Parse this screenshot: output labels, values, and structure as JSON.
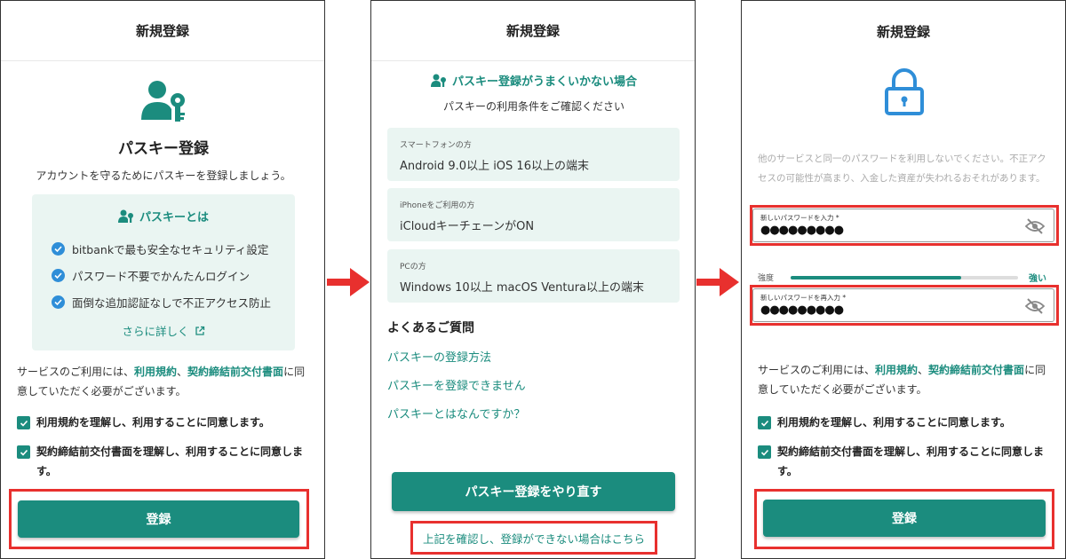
{
  "colors": {
    "accent": "#1b8c7e",
    "highlight": "#e8302e",
    "check_blue": "#2f8ed8",
    "box_bg": "#eaf5f2"
  },
  "panel1": {
    "header": "新規登録",
    "icon": "user-key-icon",
    "title": "パスキー登録",
    "subtitle": "アカウントを守るためにパスキーを登録しましょう。",
    "box": {
      "title": "パスキーとは",
      "items": [
        "bitbankで最も安全なセキュリティ設定",
        "パスワード不要でかんたんログイン",
        "面倒な追加認証なしで不正アクセス防止"
      ],
      "more": "さらに詳しく"
    },
    "agree_pre": "サービスのご利用には、",
    "terms_link": "利用規約",
    "sep": "、",
    "contract_link": "契約締結前交付書面",
    "agree_post": "に同意していただく必要がございます。",
    "check1": "利用規約を理解し、利用することに同意します。",
    "check2": "契約締結前交付書面を理解し、利用することに同意します。",
    "button": "登録"
  },
  "panel2": {
    "header": "新規登録",
    "title": "パスキー登録がうまくいかない場合",
    "subtitle": "パスキーの利用条件をご確認ください",
    "cards": [
      {
        "label": "スマートフォンの方",
        "value": "Android 9.0以上 iOS 16以上の端末"
      },
      {
        "label": "iPhoneをご利用の方",
        "value": "iCloudキーチェーンがON"
      },
      {
        "label": "PCの方",
        "value": "Windows 10以上 macOS Ventura以上の端末"
      }
    ],
    "faq_title": "よくあるご質問",
    "faq": [
      "パスキーの登録方法",
      "パスキーを登録できません",
      "パスキーとはなんですか？"
    ],
    "button": "パスキー登録をやり直す",
    "fallback_link": "上記を確認し、登録ができない場合はこちら"
  },
  "panel3": {
    "header": "新規登録",
    "icon": "lock-icon",
    "warning": "他のサービスと同一のパスワードを利用しないでください。不正アクセスの可能性が高まり、入金した資産が失われるおそれがあります。",
    "password_label": "新しいパスワードを入力 *",
    "password_value": "●●●●●●●●●",
    "confirm_label": "新しいパスワードを再入力 *",
    "confirm_value": "●●●●●●●●●",
    "strength_label": "強度",
    "strength_value": "強い",
    "strength_fraction": 0.75,
    "agree_pre": "サービスのご利用には、",
    "terms_link": "利用規約",
    "sep": "、",
    "contract_link": "契約締結前交付書面",
    "agree_post": "に同意していただく必要がございます。",
    "check1": "利用規約を理解し、利用することに同意します。",
    "check2": "契約締結前交付書面を理解し、利用することに同意します。",
    "button": "登録"
  }
}
